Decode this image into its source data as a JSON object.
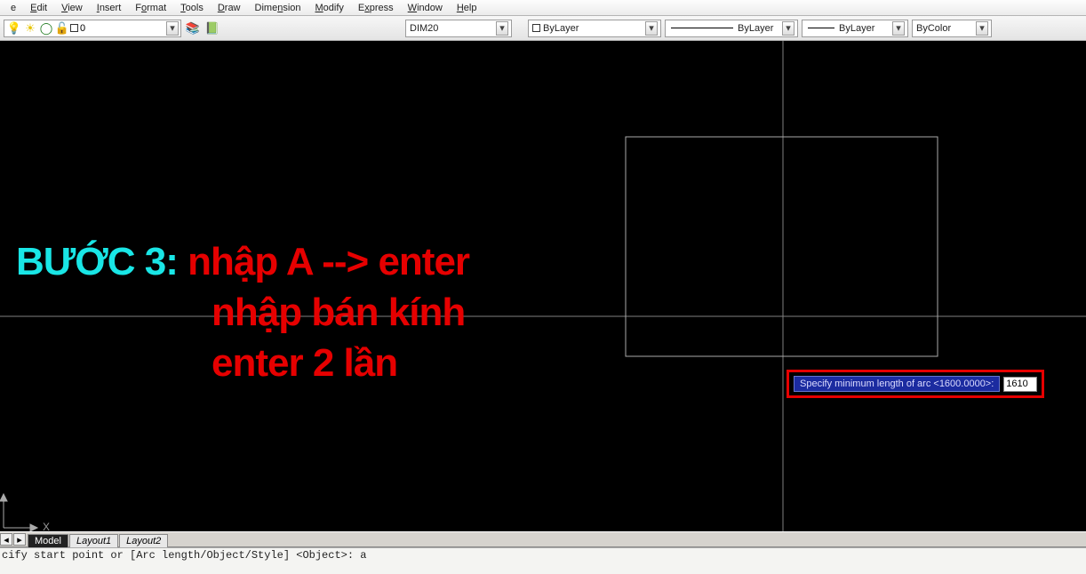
{
  "menu": {
    "items": [
      "File",
      "Edit",
      "View",
      "Insert",
      "Format",
      "Tools",
      "Draw",
      "Dimension",
      "Modify",
      "Express",
      "Window",
      "Help"
    ],
    "hotkeys": [
      "",
      "E",
      "V",
      "I",
      "",
      "T",
      "D",
      "",
      "M",
      "",
      "W",
      "H"
    ]
  },
  "toolbar": {
    "current_layer": "0",
    "dim_selector": "DIM20",
    "color_selector": "ByLayer",
    "linetype_selector": "ByLayer",
    "lineweight_selector": "ByLayer",
    "plotstyle_selector": "ByColor"
  },
  "instruction": {
    "step_label": "BƯỚC 3:",
    "line1": "nhập A --> enter",
    "line2": "nhập bán kính",
    "line3": "enter 2 lần"
  },
  "dynamic_input": {
    "prompt": "Specify minimum length of arc <1600.0000>:",
    "value": "1610"
  },
  "tabs": {
    "items": [
      "Model",
      "Layout1",
      "Layout2"
    ],
    "active": 0
  },
  "cmd": {
    "line1": "cify start point or [Arc length/Object/Style] <Object>: a",
    "line2": ""
  },
  "ucs": {
    "x_label": "X"
  }
}
